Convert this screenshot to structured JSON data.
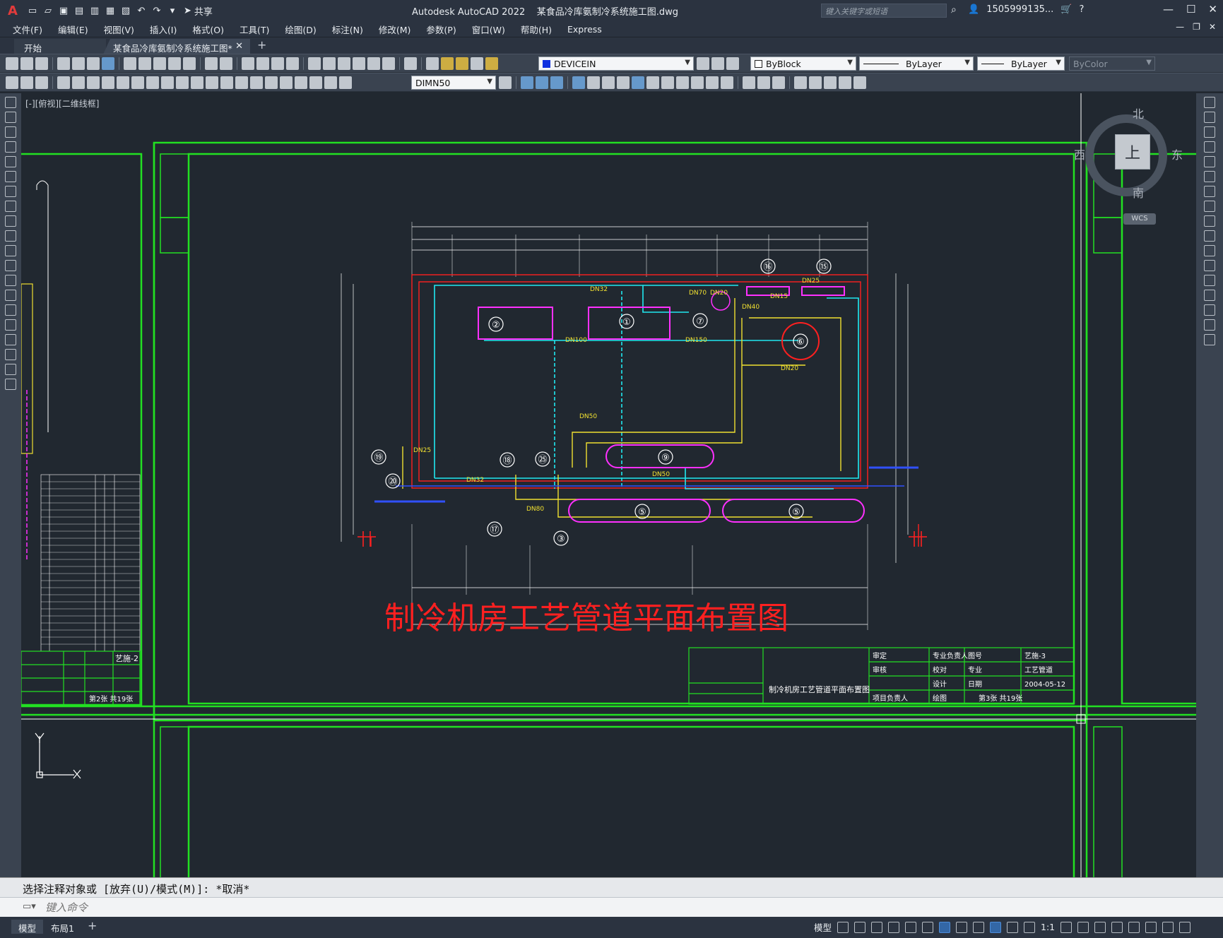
{
  "window": {
    "app_title": "Autodesk AutoCAD 2022",
    "file_title": "某食品冷库氨制冷系统施工图.dwg",
    "share_label": "共享",
    "search_placeholder": "键入关键字或短语",
    "user": "1505999135...",
    "logo": "A"
  },
  "menu": [
    "文件(F)",
    "编辑(E)",
    "视图(V)",
    "插入(I)",
    "格式(O)",
    "工具(T)",
    "绘图(D)",
    "标注(N)",
    "修改(M)",
    "参数(P)",
    "窗口(W)",
    "帮助(H)",
    "Express"
  ],
  "tabs": {
    "start": "开始",
    "active": "某食品冷库氨制冷系统施工图*"
  },
  "toolbar": {
    "layer": "DEVICEIN",
    "color": "ByBlock",
    "linetype": "ByLayer",
    "lineweight": "ByLayer",
    "plotstyle": "ByColor",
    "dimstyle": "DIMN50"
  },
  "canvas": {
    "view_label": "[-][俯视][二维线框]",
    "drawing_title": "制冷机房工艺管道平面布置图",
    "colors": {
      "background": "#212830",
      "frame": "#22e022",
      "pipe_cyan": "#20e8f0",
      "pipe_yellow": "#f0e030",
      "equip_magenta": "#ff30ff",
      "wall_red": "#ff2020"
    },
    "equipment_labels": [
      "①",
      "②",
      "③",
      "⑤",
      "⑤",
      "⑥",
      "⑦",
      "⑨",
      "⑮",
      "⑯",
      "⑰",
      "⑱",
      "⑲",
      "⑳",
      "㉕"
    ],
    "pipe_labels": [
      "DN32",
      "DN70",
      "DN20",
      "DN100",
      "DN150",
      "DN50",
      "DN25",
      "DN80",
      "DN40",
      "DN15"
    ],
    "title_block": {
      "drawing_name": "制冷机房工艺管道平面布置图",
      "sheet_no": "艺施-3",
      "prev_sheet_no": "艺施-2",
      "discipline": "工艺管道",
      "date": "2004-05-12",
      "sheet_count": "第3张 共19张",
      "prev_sheet_count": "第2张 共19张",
      "roles": [
        "审定",
        "专业负责人",
        "审核",
        "校对",
        "设计",
        "项目负责人",
        "绘图",
        "图号",
        "专业",
        "日期"
      ]
    }
  },
  "viewcube": {
    "north": "北",
    "south": "南",
    "east": "东",
    "west": "西",
    "face": "上",
    "wcs": "WCS"
  },
  "command": {
    "history": "选择注释对象或 [放弃(U)/模式(M)]: *取消*",
    "placeholder": "键入命令"
  },
  "status": {
    "model_tab": "模型",
    "layout_tab": "布局1",
    "model_label": "模型",
    "scale": "1:1"
  }
}
